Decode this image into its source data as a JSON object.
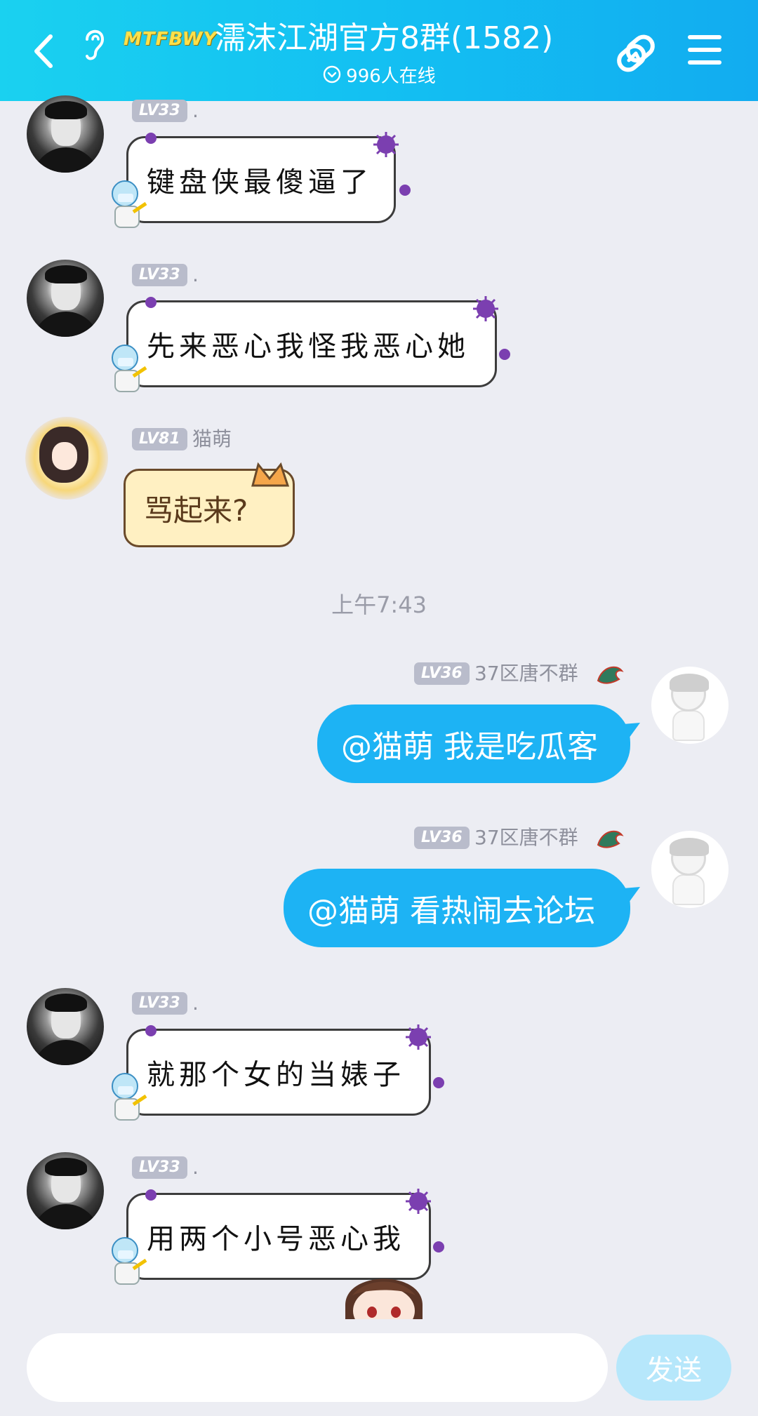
{
  "header": {
    "badge": "MTFBWY",
    "title": "濡沫江湖官方8群(1582)",
    "online": "996人在线"
  },
  "messages": [
    {
      "level": "LV33",
      "nick": ".",
      "text": "键盘侠最傻逼了",
      "side": "left",
      "bubble": "virus"
    },
    {
      "level": "LV33",
      "nick": ".",
      "text": "先来恶心我怪我恶心她",
      "side": "left",
      "bubble": "virus"
    },
    {
      "level": "LV81",
      "nick": "猫萌",
      "text": "骂起来?",
      "side": "left",
      "bubble": "cat"
    },
    {
      "level": "LV36",
      "nick": "37区唐不群",
      "text": "@猫萌 我是吃瓜客",
      "side": "right",
      "bubble": "self"
    },
    {
      "level": "LV36",
      "nick": "37区唐不群",
      "text": "@猫萌 看热闹去论坛",
      "side": "right",
      "bubble": "self"
    },
    {
      "level": "LV33",
      "nick": ".",
      "text": "就那个女的当婊子",
      "side": "left",
      "bubble": "virus"
    },
    {
      "level": "LV33",
      "nick": ".",
      "text": "用两个小号恶心我",
      "side": "left",
      "bubble": "virus"
    }
  ],
  "timestamp": "上午7:43",
  "input": {
    "value": "",
    "placeholder": ""
  },
  "send_label": "发送",
  "icons": {
    "back": "chevron-left-icon",
    "ear": "ear-icon",
    "online": "chevron-down-circle-icon",
    "share": "link-share-icon",
    "menu": "hamburger-menu-icon"
  },
  "colors": {
    "header_start": "#1AD1F0",
    "header_end": "#12ACF0",
    "self_bubble": "#1DB3F4",
    "send_button": "#B6E7FB",
    "background": "#ECEDF3"
  }
}
